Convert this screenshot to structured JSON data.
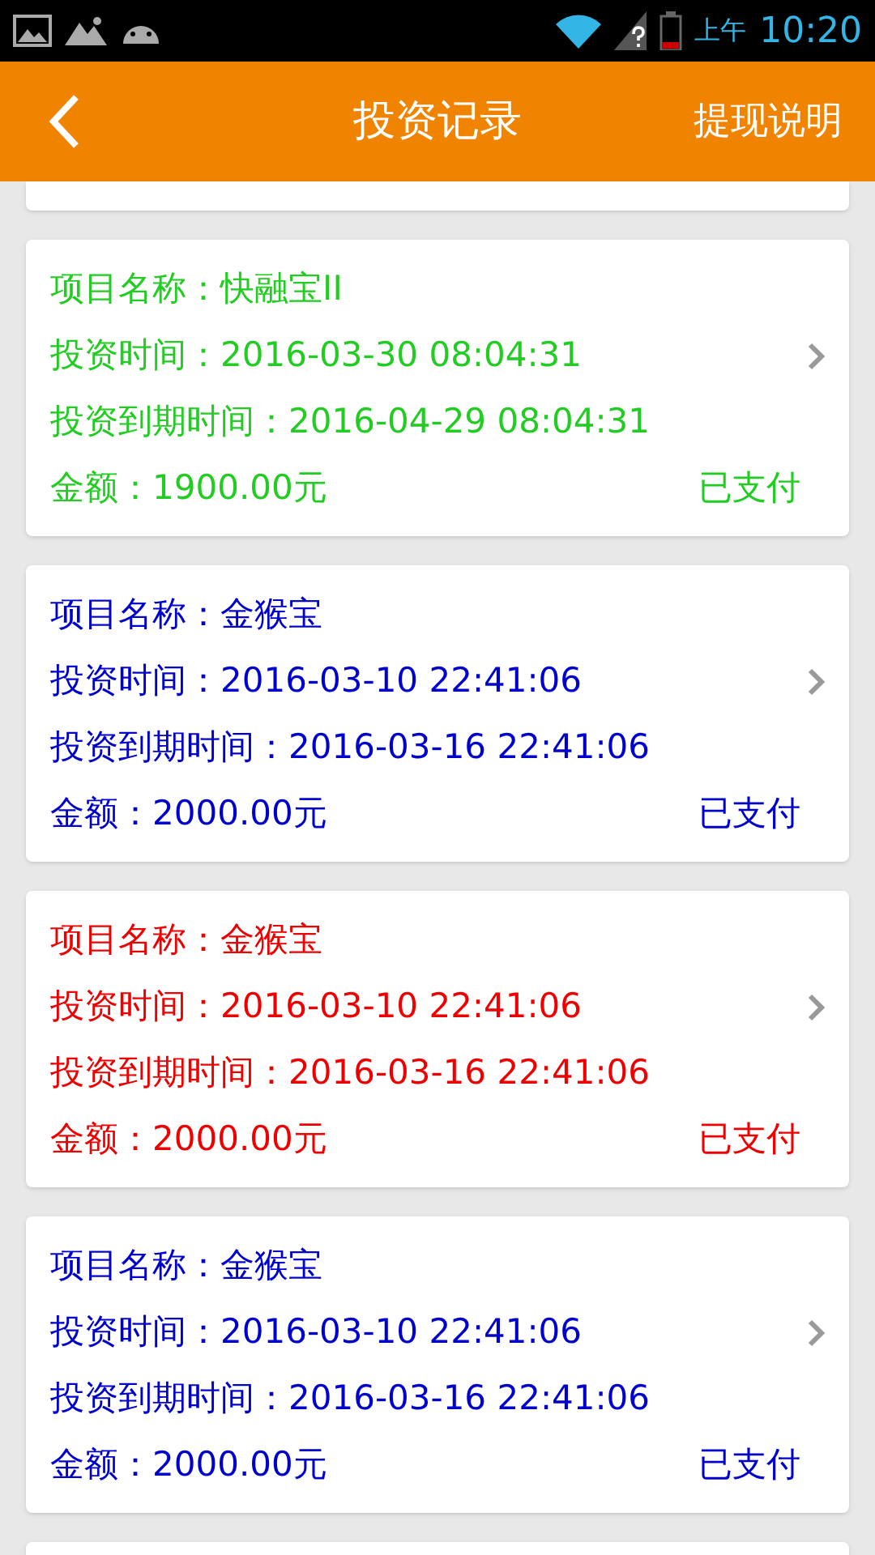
{
  "status_bar": {
    "ampm": "上午",
    "time": "10:20"
  },
  "header": {
    "title": "投资记录",
    "action": "提现说明"
  },
  "records": [
    {
      "color": "#22cc22",
      "name": "项目名称：快融宝II",
      "invest_time": "投资时间：2016-03-30 08:04:31",
      "due_time": "投资到期时间：2016-04-29 08:04:31",
      "amount": "金额：1900.00元",
      "status": "已支付"
    },
    {
      "color": "#0000cc",
      "name": "项目名称：金猴宝",
      "invest_time": "投资时间：2016-03-10 22:41:06",
      "due_time": "投资到期时间：2016-03-16 22:41:06",
      "amount": "金额：2000.00元",
      "status": "已支付"
    },
    {
      "color": "#ee0000",
      "name": "项目名称：金猴宝",
      "invest_time": "投资时间：2016-03-10 22:41:06",
      "due_time": "投资到期时间：2016-03-16 22:41:06",
      "amount": "金额：2000.00元",
      "status": "已支付"
    },
    {
      "color": "#0000cc",
      "name": "项目名称：金猴宝",
      "invest_time": "投资时间：2016-03-10 22:41:06",
      "due_time": "投资到期时间：2016-03-16 22:41:06",
      "amount": "金额：2000.00元",
      "status": "已支付"
    }
  ]
}
